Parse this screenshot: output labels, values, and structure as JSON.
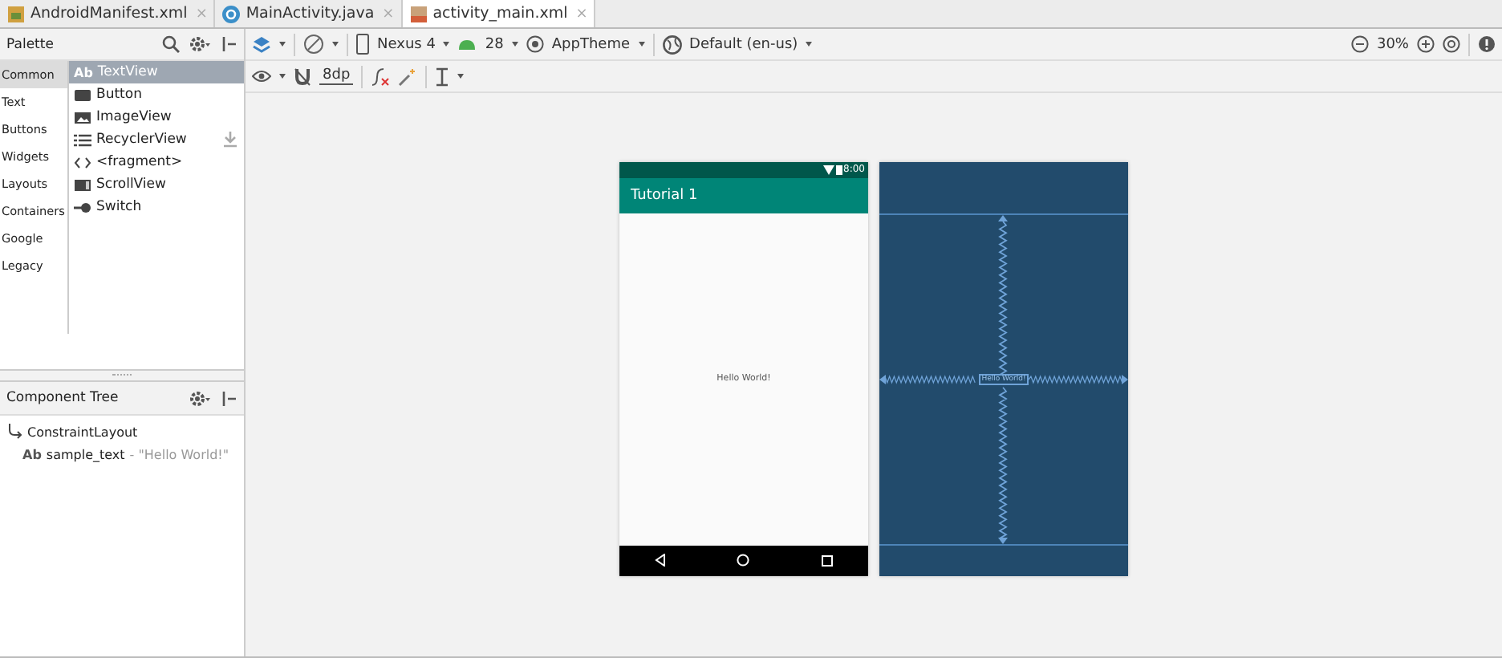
{
  "tabs": [
    {
      "label": "AndroidManifest.xml",
      "kind": "manifest",
      "selected": false,
      "close": "×"
    },
    {
      "label": "MainActivity.java",
      "kind": "java",
      "selected": false,
      "close": "×"
    },
    {
      "label": "activity_main.xml",
      "kind": "layout",
      "selected": true,
      "close": "×"
    }
  ],
  "palette": {
    "title": "Palette",
    "categories": [
      {
        "label": "Common",
        "selected": true
      },
      {
        "label": "Text",
        "selected": false
      },
      {
        "label": "Buttons",
        "selected": false
      },
      {
        "label": "Widgets",
        "selected": false
      },
      {
        "label": "Layouts",
        "selected": false
      },
      {
        "label": "Containers",
        "selected": false
      },
      {
        "label": "Google",
        "selected": false
      },
      {
        "label": "Legacy",
        "selected": false
      }
    ],
    "items": [
      {
        "label": "TextView",
        "icon": "Ab",
        "kind": "text",
        "selected": true
      },
      {
        "label": "Button",
        "kind": "button",
        "selected": false
      },
      {
        "label": "ImageView",
        "kind": "image",
        "selected": false
      },
      {
        "label": "RecyclerView",
        "kind": "list",
        "selected": false,
        "download": true
      },
      {
        "label": "<fragment>",
        "kind": "code",
        "selected": false
      },
      {
        "label": "ScrollView",
        "kind": "scroll",
        "selected": false
      },
      {
        "label": "Switch",
        "kind": "switch",
        "selected": false
      }
    ]
  },
  "component_tree": {
    "title": "Component Tree",
    "items": [
      {
        "label": "ConstraintLayout",
        "kind": "layout",
        "children": [
          {
            "label": "sample_text",
            "icon": "Ab",
            "kind": "text",
            "detail": "- \"Hello World!\""
          }
        ]
      }
    ]
  },
  "toolbar": {
    "device": "Nexus 4",
    "api": "28",
    "theme": "AppTheme",
    "locale": "Default (en-us)",
    "margin": "8dp",
    "zoom": "30%"
  },
  "preview": {
    "status_time": "8:00",
    "app_title": "Tutorial 1",
    "text": "Hello World!"
  },
  "blueprint": {
    "text": "Hello World!"
  }
}
